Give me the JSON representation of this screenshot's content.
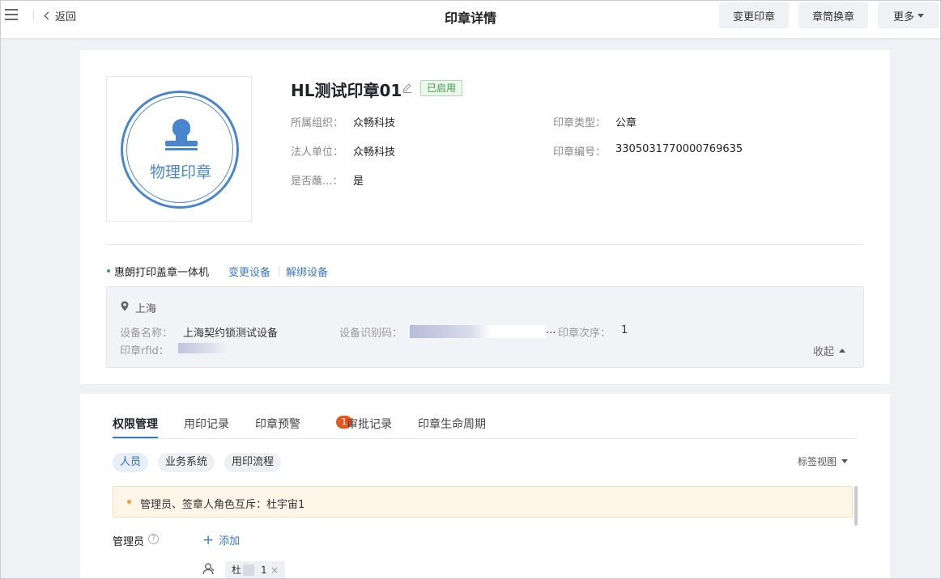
{
  "header": {
    "back_label": "返回",
    "title": "印章详情",
    "buttons": {
      "change_seal": "变更印章",
      "replace_cartridge": "章筒换章",
      "more": "更多"
    }
  },
  "seal": {
    "image_text": "物理印章",
    "name": "HL测试印章01",
    "status": "已启用",
    "fields": {
      "org_label": "所属组织：",
      "org_value": "众畅科技",
      "legal_label": "法人单位：",
      "legal_value": "众畅科技",
      "ink_label": "是否蘸...：",
      "ink_value": "是",
      "type_label": "印章类型：",
      "type_value": "公章",
      "code_label": "印章编号：",
      "code_value": "3305031770000769635"
    }
  },
  "device": {
    "name": "惠朗打印盖章一体机",
    "change_link": "变更设备",
    "unbind_link": "解绑设备",
    "location": "上海",
    "name_label": "设备名称：",
    "name_value": "上海契约锁测试设备",
    "id_label": "设备识别码：",
    "id_suffix": "...",
    "order_label": "印章次序：",
    "order_value": "1",
    "rfid_label": "印章rfid：",
    "collapse_label": "收起"
  },
  "tabs": [
    {
      "label": "权限管理"
    },
    {
      "label": "用印记录"
    },
    {
      "label": "印章预警",
      "badge": "1"
    },
    {
      "label": "审批记录"
    },
    {
      "label": "印章生命周期"
    }
  ],
  "filters": {
    "chips": [
      "人员",
      "业务系统",
      "用印流程"
    ],
    "view_select": "标签视图"
  },
  "warning": {
    "text": "管理员、签章人角色互斥：杜宇宙1"
  },
  "admins": {
    "label": "管理员",
    "add_label": "添加",
    "user_prefix": "杜",
    "user_suffix": "1",
    "remove": "×"
  },
  "colors": {
    "accent": "#3a78c8",
    "seal_blue": "#4a86cf",
    "status_green": "#3aa04a",
    "badge_orange": "#e8561f",
    "warning_dot": "#f0a020"
  }
}
